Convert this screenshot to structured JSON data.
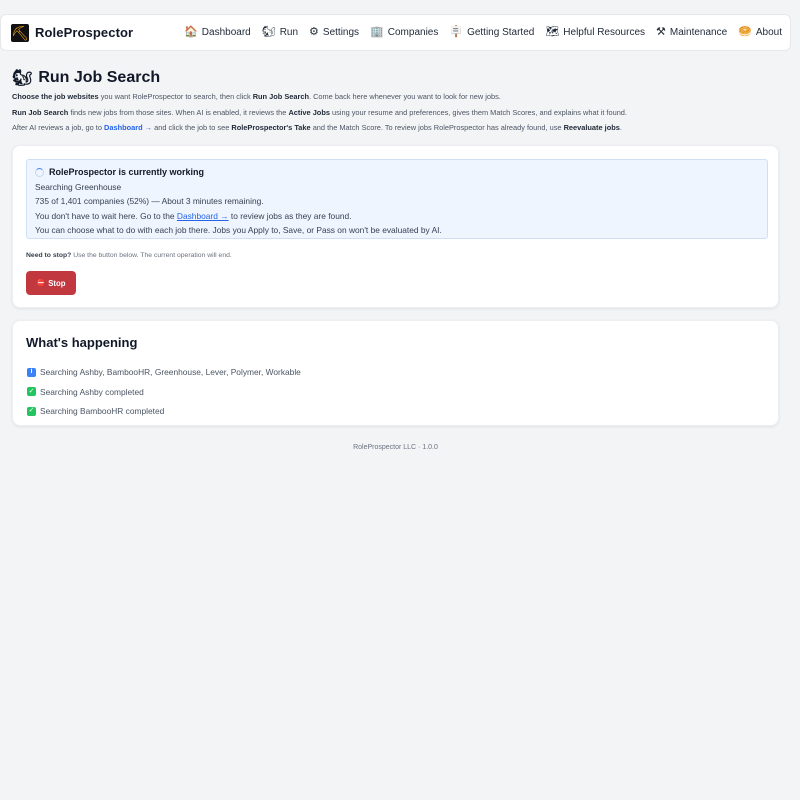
{
  "app": {
    "name": "RoleProspector",
    "logo_icon": "pickaxe-logo-icon"
  },
  "nav": [
    {
      "label": "Dashboard",
      "icon": "🏠",
      "icon_name": "house-icon"
    },
    {
      "label": "Run",
      "icon": "🐿",
      "icon_name": "squirrel-icon"
    },
    {
      "label": "Settings",
      "icon": "⚙",
      "icon_name": "gear-icon"
    },
    {
      "label": "Companies",
      "icon": "🏢",
      "icon_name": "building-icon"
    },
    {
      "label": "Getting Started",
      "icon": "🪧",
      "icon_name": "signpost-icon"
    },
    {
      "label": "Helpful Resources",
      "icon": "🗺",
      "icon_name": "map-icon"
    },
    {
      "label": "Maintenance",
      "icon": "⚒",
      "icon_name": "hammer-pick-icon"
    },
    {
      "label": "About",
      "icon": "🥯",
      "icon_name": "nugget-icon"
    }
  ],
  "header": {
    "title": "Run Job Search",
    "title_icon": "🐿",
    "intro1": {
      "b1": "Choose the job websites",
      "t1": " you want RoleProspector to search, then click ",
      "b2": "Run Job Search",
      "t2": ". Come back here whenever you want to look for new jobs."
    },
    "intro2": {
      "b1": "Run Job Search",
      "t1": " finds new jobs from those sites. When AI is enabled, it reviews the ",
      "b2": "Active Jobs",
      "t2": " using your resume and preferences, gives them Match Scores, and explains what it found."
    },
    "intro3": {
      "t1": "After AI reviews a job, go to ",
      "link": "Dashboard →",
      "t2": " and click the job to see ",
      "b1": "RoleProspector's Take",
      "t3": " and the Match Score. To review jobs RoleProspector has already found, use ",
      "b2": "Reevaluate jobs",
      "t4": "."
    }
  },
  "status": {
    "heading": "RoleProspector is currently working",
    "line1": "Searching Greenhouse",
    "line2": "735 of 1,401 companies (52%) — About 3 minutes remaining.",
    "progress_percent": 52,
    "line3_pre": "You don't have to wait here. Go to the ",
    "line3_link": "Dashboard →",
    "line3_post": " to review jobs as they are found.",
    "line4": "You can choose what to do with each job there. Jobs you Apply to, Save, or Pass on won't be evaluated by AI."
  },
  "stop": {
    "note_bold": "Need to stop?",
    "note_text": " Use the button below. The current operation will end.",
    "button_label": "Stop",
    "button_color": "#c2383f"
  },
  "happening": {
    "title": "What's happening",
    "items": [
      {
        "text": "Searching Ashby, BambooHR, Greenhouse, Lever, Polymer, Workable",
        "kind": "info"
      },
      {
        "text": "Searching Ashby completed",
        "kind": "done"
      },
      {
        "text": "Searching BambooHR completed",
        "kind": "done"
      }
    ]
  },
  "footer": {
    "text": "RoleProspector LLC · 1.0.0"
  },
  "colors": {
    "accent": "#2563eb",
    "background": "#f3f4f6",
    "status_bg": "#eef5ff",
    "success": "#22c55e"
  }
}
